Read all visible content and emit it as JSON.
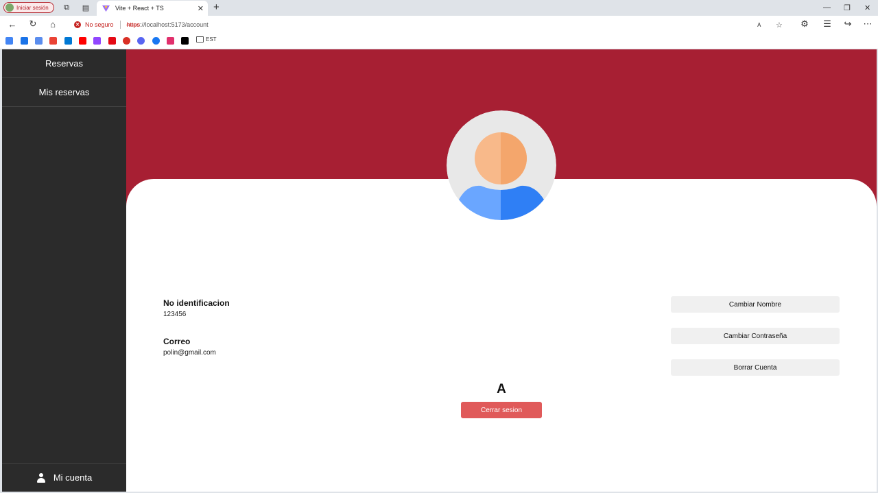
{
  "browser": {
    "profile_label": "Iniciar sesión",
    "tab_title": "Vite + React + TS",
    "security_label": "No seguro",
    "url_scheme": "https",
    "url_rest": "://localhost:5173/account",
    "bookmark_folder": "EST",
    "bookmark_icons": [
      "google-icon",
      "search-icon",
      "translate-icon",
      "gmail-icon",
      "outlook-icon",
      "youtube-icon",
      "twitch-icon",
      "netflix-icon",
      "app-icon",
      "discord-icon",
      "facebook-icon",
      "instagram-icon",
      "x-icon"
    ],
    "colors": {
      "insecure": "#c5221f"
    }
  },
  "sidebar": {
    "items": [
      {
        "label": "Reservas"
      },
      {
        "label": "Mis reservas"
      }
    ],
    "account_label": "Mi cuenta"
  },
  "profile": {
    "name": "A",
    "id_label": "No identificacion",
    "id_value": "123456",
    "email_label": "Correo",
    "email_value": "polin@gmail.com"
  },
  "actions": {
    "change_name": "Cambiar Nombre",
    "change_password": "Cambiar Contraseña",
    "delete_account": "Borrar Cuenta",
    "logout": "Cerrar sesion"
  },
  "colors": {
    "header": "#a71f33",
    "sidebar": "#2b2b2b",
    "logout": "#e05a5a"
  }
}
